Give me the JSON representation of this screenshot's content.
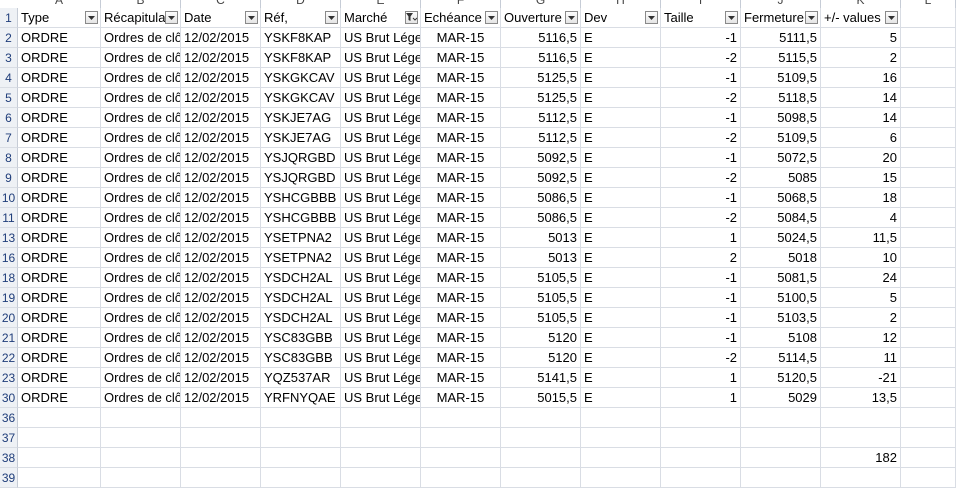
{
  "columns": [
    {
      "letter": "A",
      "header": "Type",
      "align": "l"
    },
    {
      "letter": "B",
      "header": "Récapitulatif",
      "align": "l"
    },
    {
      "letter": "C",
      "header": "Date",
      "align": "l"
    },
    {
      "letter": "D",
      "header": "Réf,",
      "align": "l"
    },
    {
      "letter": "E",
      "header": "Marché",
      "align": "l",
      "filtered": true
    },
    {
      "letter": "F",
      "header": "Echéance",
      "align": "c"
    },
    {
      "letter": "G",
      "header": "Ouverture",
      "align": "r"
    },
    {
      "letter": "H",
      "header": "Dev",
      "align": "l"
    },
    {
      "letter": "I",
      "header": "Taille",
      "align": "r"
    },
    {
      "letter": "J",
      "header": "Fermeture",
      "align": "r"
    },
    {
      "letter": "K",
      "header": "+/- values",
      "align": "r"
    },
    {
      "letter": "L",
      "header": "",
      "align": "l"
    }
  ],
  "header_row_number": "1",
  "rows": [
    {
      "num": "2",
      "cells": [
        "ORDRE",
        "Ordres de clôture",
        "12/02/2015",
        "YSKF8KAP",
        "US Brut Léger",
        "MAR-15",
        "5116,5",
        "E",
        "-1",
        "5111,5",
        "5"
      ]
    },
    {
      "num": "3",
      "cells": [
        "ORDRE",
        "Ordres de clôture",
        "12/02/2015",
        "YSKF8KAP",
        "US Brut Léger",
        "MAR-15",
        "5116,5",
        "E",
        "-2",
        "5115,5",
        "2"
      ]
    },
    {
      "num": "4",
      "cells": [
        "ORDRE",
        "Ordres de clôture",
        "12/02/2015",
        "YSKGKCAV",
        "US Brut Léger",
        "MAR-15",
        "5125,5",
        "E",
        "-1",
        "5109,5",
        "16"
      ]
    },
    {
      "num": "5",
      "cells": [
        "ORDRE",
        "Ordres de clôture",
        "12/02/2015",
        "YSKGKCAV",
        "US Brut Léger",
        "MAR-15",
        "5125,5",
        "E",
        "-2",
        "5118,5",
        "14"
      ]
    },
    {
      "num": "6",
      "cells": [
        "ORDRE",
        "Ordres de clôture",
        "12/02/2015",
        "YSKJE7AG",
        "US Brut Léger",
        "MAR-15",
        "5112,5",
        "E",
        "-1",
        "5098,5",
        "14"
      ]
    },
    {
      "num": "7",
      "cells": [
        "ORDRE",
        "Ordres de clôture",
        "12/02/2015",
        "YSKJE7AG",
        "US Brut Léger",
        "MAR-15",
        "5112,5",
        "E",
        "-2",
        "5109,5",
        "6"
      ]
    },
    {
      "num": "8",
      "cells": [
        "ORDRE",
        "Ordres de clôture",
        "12/02/2015",
        "YSJQRGBD",
        "US Brut Léger",
        "MAR-15",
        "5092,5",
        "E",
        "-1",
        "5072,5",
        "20"
      ]
    },
    {
      "num": "9",
      "cells": [
        "ORDRE",
        "Ordres de clôture",
        "12/02/2015",
        "YSJQRGBD",
        "US Brut Léger",
        "MAR-15",
        "5092,5",
        "E",
        "-2",
        "5085",
        "15"
      ]
    },
    {
      "num": "10",
      "cells": [
        "ORDRE",
        "Ordres de clôture",
        "12/02/2015",
        "YSHCGBBB",
        "US Brut Léger",
        "MAR-15",
        "5086,5",
        "E",
        "-1",
        "5068,5",
        "18"
      ]
    },
    {
      "num": "11",
      "cells": [
        "ORDRE",
        "Ordres de clôture",
        "12/02/2015",
        "YSHCGBBB",
        "US Brut Léger",
        "MAR-15",
        "5086,5",
        "E",
        "-2",
        "5084,5",
        "4"
      ]
    },
    {
      "num": "13",
      "cells": [
        "ORDRE",
        "Ordres de clôture",
        "12/02/2015",
        "YSETPNA2",
        "US Brut Léger",
        "MAR-15",
        "5013",
        "E",
        "1",
        "5024,5",
        "11,5"
      ]
    },
    {
      "num": "16",
      "cells": [
        "ORDRE",
        "Ordres de clôture",
        "12/02/2015",
        "YSETPNA2",
        "US Brut Léger",
        "MAR-15",
        "5013",
        "E",
        "2",
        "5018",
        "10"
      ]
    },
    {
      "num": "18",
      "cells": [
        "ORDRE",
        "Ordres de clôture",
        "12/02/2015",
        "YSDCH2AL",
        "US Brut Léger",
        "MAR-15",
        "5105,5",
        "E",
        "-1",
        "5081,5",
        "24"
      ]
    },
    {
      "num": "19",
      "cells": [
        "ORDRE",
        "Ordres de clôture",
        "12/02/2015",
        "YSDCH2AL",
        "US Brut Léger",
        "MAR-15",
        "5105,5",
        "E",
        "-1",
        "5100,5",
        "5"
      ]
    },
    {
      "num": "20",
      "cells": [
        "ORDRE",
        "Ordres de clôture",
        "12/02/2015",
        "YSDCH2AL",
        "US Brut Léger",
        "MAR-15",
        "5105,5",
        "E",
        "-1",
        "5103,5",
        "2"
      ]
    },
    {
      "num": "21",
      "cells": [
        "ORDRE",
        "Ordres de clôture",
        "12/02/2015",
        "YSC83GBB",
        "US Brut Léger",
        "MAR-15",
        "5120",
        "E",
        "-1",
        "5108",
        "12"
      ]
    },
    {
      "num": "22",
      "cells": [
        "ORDRE",
        "Ordres de clôture",
        "12/02/2015",
        "YSC83GBB",
        "US Brut Léger",
        "MAR-15",
        "5120",
        "E",
        "-2",
        "5114,5",
        "11"
      ]
    },
    {
      "num": "23",
      "cells": [
        "ORDRE",
        "Ordres de clôture",
        "12/02/2015",
        "YQZ537AR",
        "US Brut Léger",
        "MAR-15",
        "5141,5",
        "E",
        "1",
        "5120,5",
        "-21"
      ]
    },
    {
      "num": "30",
      "cells": [
        "ORDRE",
        "Ordres de clôture",
        "12/02/2015",
        "YRFNYQAE",
        "US Brut Léger",
        "MAR-15",
        "5015,5",
        "E",
        "1",
        "5029",
        "13,5"
      ]
    },
    {
      "num": "36",
      "cells": [
        "",
        "",
        "",
        "",
        "",
        "",
        "",
        "",
        "",
        "",
        ""
      ]
    },
    {
      "num": "37",
      "cells": [
        "",
        "",
        "",
        "",
        "",
        "",
        "",
        "",
        "",
        "",
        ""
      ]
    },
    {
      "num": "38",
      "cells": [
        "",
        "",
        "",
        "",
        "",
        "",
        "",
        "",
        "",
        "",
        "182"
      ]
    },
    {
      "num": "39",
      "cells": [
        "",
        "",
        "",
        "",
        "",
        "",
        "",
        "",
        "",
        "",
        ""
      ]
    }
  ]
}
